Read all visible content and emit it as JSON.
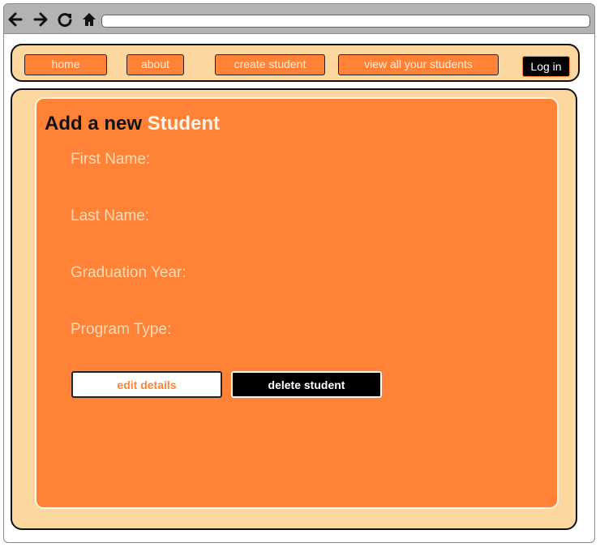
{
  "nav": {
    "home": "home",
    "about": "about",
    "create_student": "create student",
    "view_all": "view all your students",
    "login": "Log in"
  },
  "form": {
    "heading_prefix": "Add a new",
    "heading_highlight": "Student",
    "fields": [
      {
        "label": "First Name:"
      },
      {
        "label": "Last Name:"
      },
      {
        "label": "Graduation Year:"
      },
      {
        "label": "Program Type:"
      }
    ],
    "edit_button": "edit details",
    "delete_button": "delete student"
  },
  "icons": {
    "back": "arrow-left-icon",
    "forward": "arrow-right-icon",
    "reload": "reload-icon",
    "home": "home-icon"
  },
  "colors": {
    "accent_orange": "#ff8236",
    "panel_peach": "#fdd7a0",
    "browser_gray": "#b3b3b3",
    "label_text": "#fddcb8",
    "dark": "#000000"
  }
}
